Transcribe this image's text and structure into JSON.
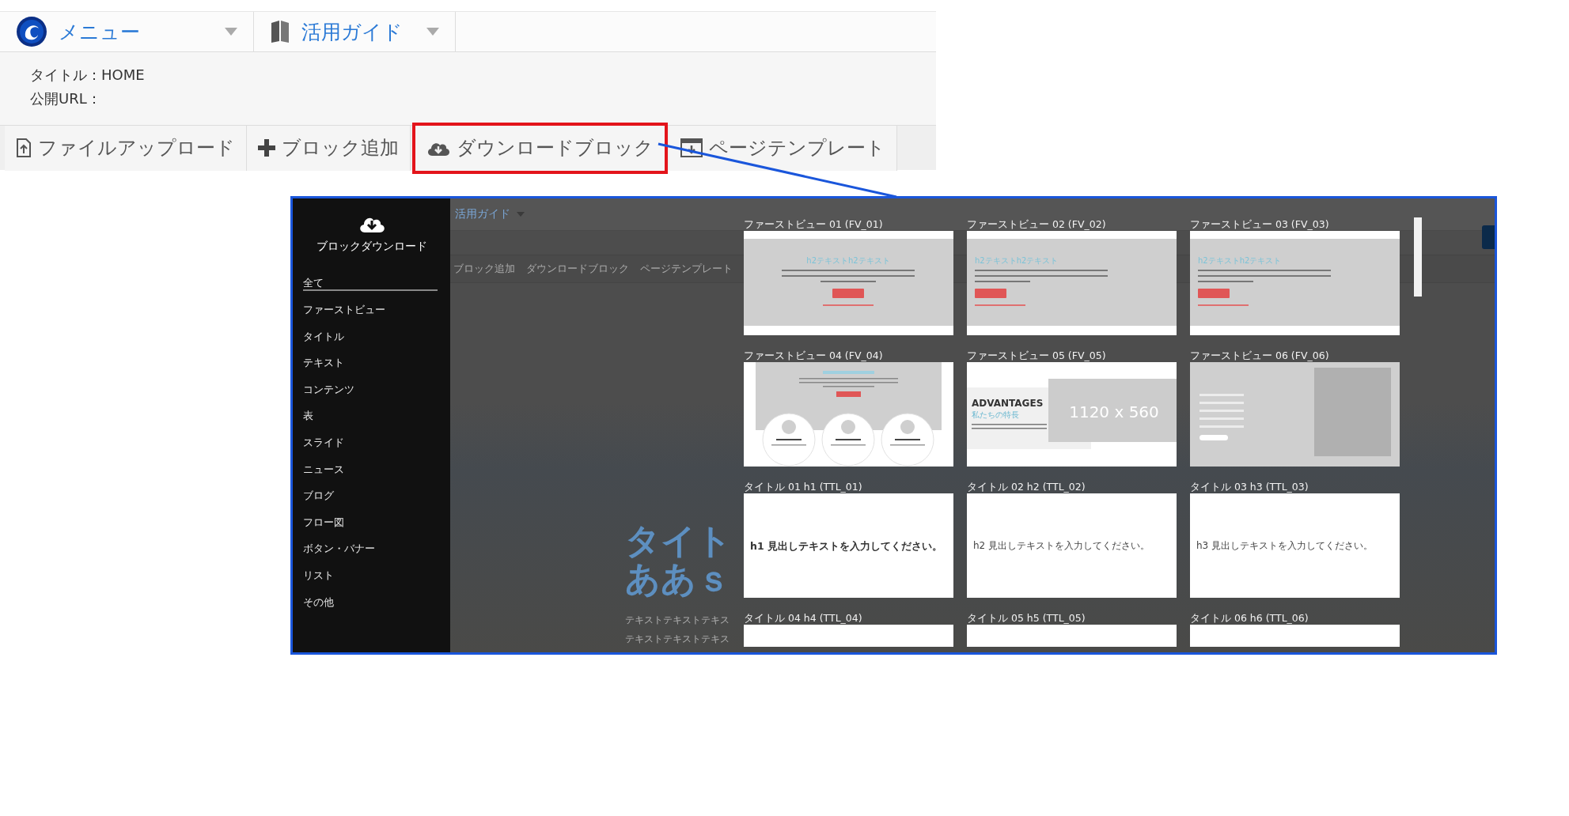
{
  "menubar": {
    "items": [
      {
        "kind": "logo",
        "label": "メニュー"
      },
      {
        "kind": "guide",
        "label": "活用ガイド"
      }
    ]
  },
  "page_info": {
    "title_line": "タイトル：HOME",
    "url_line": "公開URL："
  },
  "toolbar": [
    {
      "label": "ファイルアップロード",
      "highlighted": false
    },
    {
      "label": "ブロック追加",
      "highlighted": false
    },
    {
      "label": "ダウンロードブロック",
      "highlighted": true
    },
    {
      "label": "ページテンプレート",
      "highlighted": false
    }
  ],
  "inset": {
    "background": {
      "menu_label": "活用ガイド",
      "toolbar": [
        "ブロック追加",
        "ダウンロードブロック",
        "ページテンプレート"
      ],
      "heading_lines": [
        "タイト",
        "ああｓ"
      ],
      "body_lines": [
        "テキストテキストテキス",
        "テキストテキストテキス"
      ]
    },
    "panel": {
      "title": "ブロックダウンロード",
      "categories": [
        {
          "label": "全て",
          "selected": true
        },
        {
          "label": "ファーストビュー",
          "selected": false
        },
        {
          "label": "タイトル",
          "selected": false
        },
        {
          "label": "テキスト",
          "selected": false
        },
        {
          "label": "コンテンツ",
          "selected": false
        },
        {
          "label": "表",
          "selected": false
        },
        {
          "label": "スライド",
          "selected": false
        },
        {
          "label": "ニュース",
          "selected": false
        },
        {
          "label": "ブログ",
          "selected": false
        },
        {
          "label": "フロー図",
          "selected": false
        },
        {
          "label": "ボタン・バナー",
          "selected": false
        },
        {
          "label": "リスト",
          "selected": false
        },
        {
          "label": "その他",
          "selected": false
        }
      ]
    },
    "blocks": [
      {
        "label": "ファーストビュー 01 (FV_01)",
        "kind": "fv-center",
        "heading": "h2テキストh2テキスト"
      },
      {
        "label": "ファーストビュー 02 (FV_02)",
        "kind": "fv-left",
        "heading": "h2テキストh2テキスト"
      },
      {
        "label": "ファーストビュー 03 (FV_03)",
        "kind": "fv-left",
        "heading": "h2テキストh2テキスト"
      },
      {
        "label": "ファーストビュー 04 (FV_04)",
        "kind": "fv-circles"
      },
      {
        "label": "ファーストビュー 05 (FV_05)",
        "kind": "fv-advantages",
        "heading": "ADVANTAGES",
        "subheading": "私たちの特長",
        "image_size": "1120 x 560"
      },
      {
        "label": "ファーストビュー 06 (FV_06)",
        "kind": "fv-side"
      },
      {
        "label": "タイトル 01 h1 (TTL_01)",
        "kind": "title-large",
        "text": "h1 見出しテキストを入力してください。"
      },
      {
        "label": "タイトル 02 h2 (TTL_02)",
        "kind": "title-small",
        "text": "h2 見出しテキストを入力してください。"
      },
      {
        "label": "タイトル 03 h3 (TTL_03)",
        "kind": "title-small",
        "text": "h3 見出しテキストを入力してください。"
      },
      {
        "label": "タイトル 04 h4 (TTL_04)",
        "kind": "blank"
      },
      {
        "label": "タイトル 05 h5 (TTL_05)",
        "kind": "blank"
      },
      {
        "label": "タイトル 06 h6 (TTL_06)",
        "kind": "blank"
      }
    ]
  }
}
